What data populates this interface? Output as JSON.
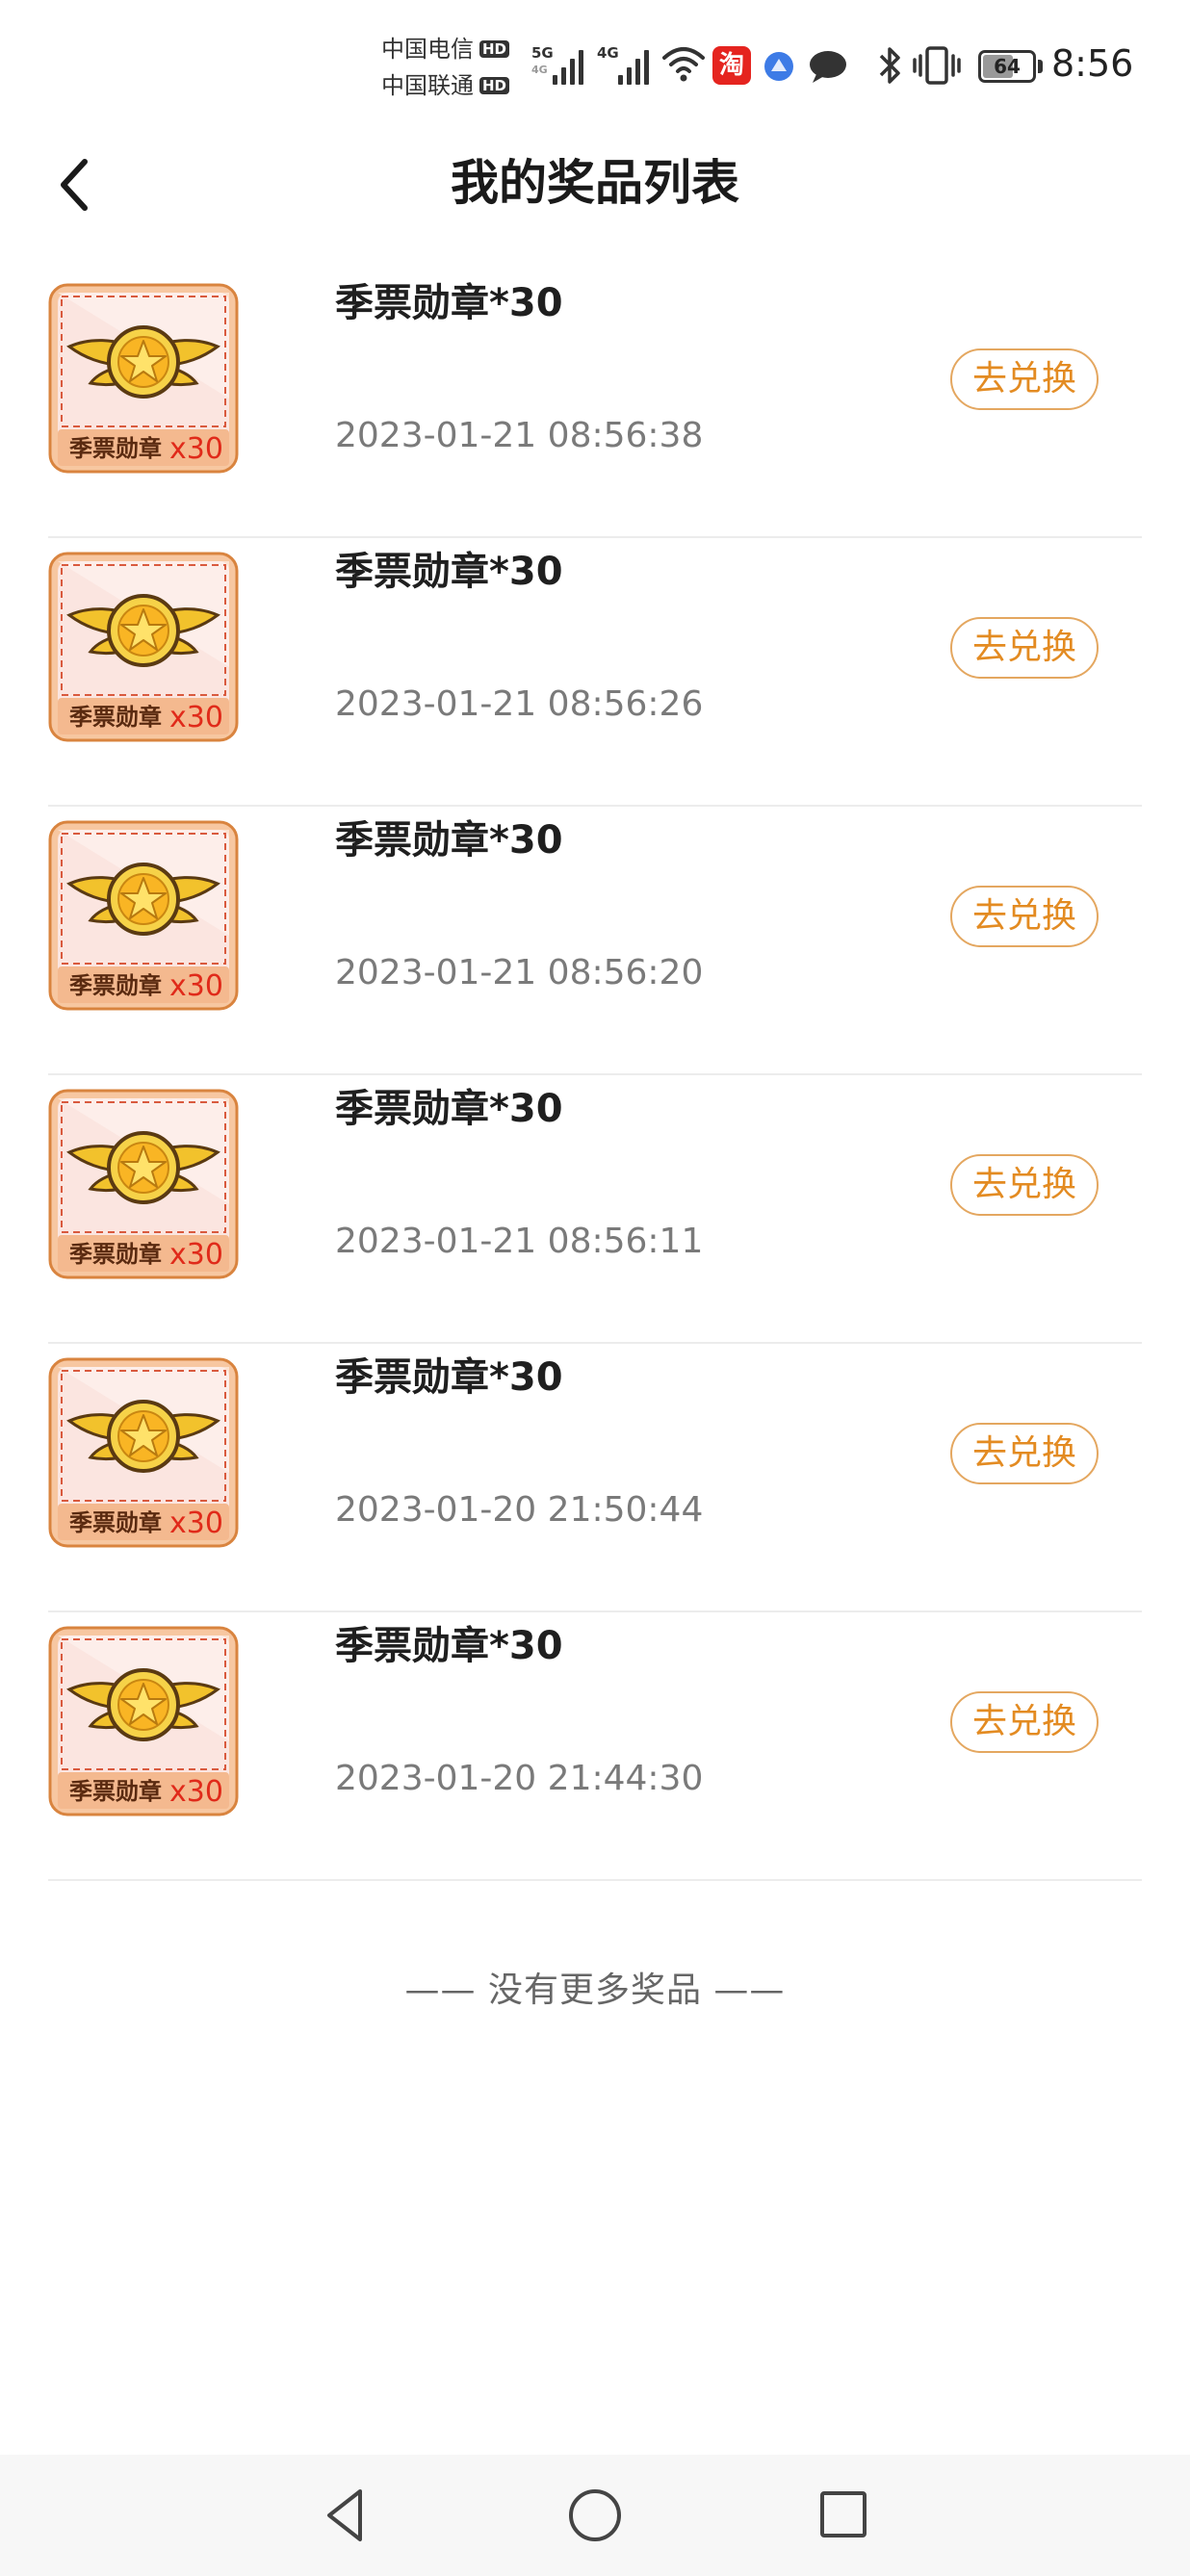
{
  "status_bar": {
    "carrier_1": "中国电信",
    "carrier_2": "中国联通",
    "hd_label": "HD",
    "net_1_top": "5G",
    "net_1_bottom": "4G",
    "net_2": "4G",
    "taobao_glyph": "淘",
    "battery": "64",
    "battery_level": 0.64,
    "time": "8:56",
    "icons": [
      "signal-icon",
      "wifi-icon",
      "taobao-app-icon",
      "browser-icon",
      "chat-icon",
      "bluetooth-icon",
      "vibrate-icon",
      "battery-icon"
    ]
  },
  "header": {
    "title": "我的奖品列表",
    "back_icon": "chevron-left-icon"
  },
  "prizes": [
    {
      "name": "季票勋章*30",
      "time": "2023-01-21 08:56:38",
      "action": "去兑换",
      "thumb_label": "季票勋章",
      "thumb_count": "x30"
    },
    {
      "name": "季票勋章*30",
      "time": "2023-01-21 08:56:26",
      "action": "去兑换",
      "thumb_label": "季票勋章",
      "thumb_count": "x30"
    },
    {
      "name": "季票勋章*30",
      "time": "2023-01-21 08:56:20",
      "action": "去兑换",
      "thumb_label": "季票勋章",
      "thumb_count": "x30"
    },
    {
      "name": "季票勋章*30",
      "time": "2023-01-21 08:56:11",
      "action": "去兑换",
      "thumb_label": "季票勋章",
      "thumb_count": "x30"
    },
    {
      "name": "季票勋章*30",
      "time": "2023-01-20 21:50:44",
      "action": "去兑换",
      "thumb_label": "季票勋章",
      "thumb_count": "x30"
    },
    {
      "name": "季票勋章*30",
      "time": "2023-01-20 21:44:30",
      "action": "去兑换",
      "thumb_label": "季票勋章",
      "thumb_count": "x30"
    }
  ],
  "footer": {
    "no_more": "—— 没有更多奖品 ——"
  },
  "colors": {
    "accent": "#e38b22",
    "accent_border": "#e4a760",
    "thumb_border": "#e9a05a",
    "thumb_bg": "#f8d9cf",
    "thumb_count": "#e02a1a",
    "gold": "#f2c22c"
  },
  "nav": {
    "back": "triangle-back-icon",
    "home": "circle-home-icon",
    "recents": "square-recents-icon"
  }
}
